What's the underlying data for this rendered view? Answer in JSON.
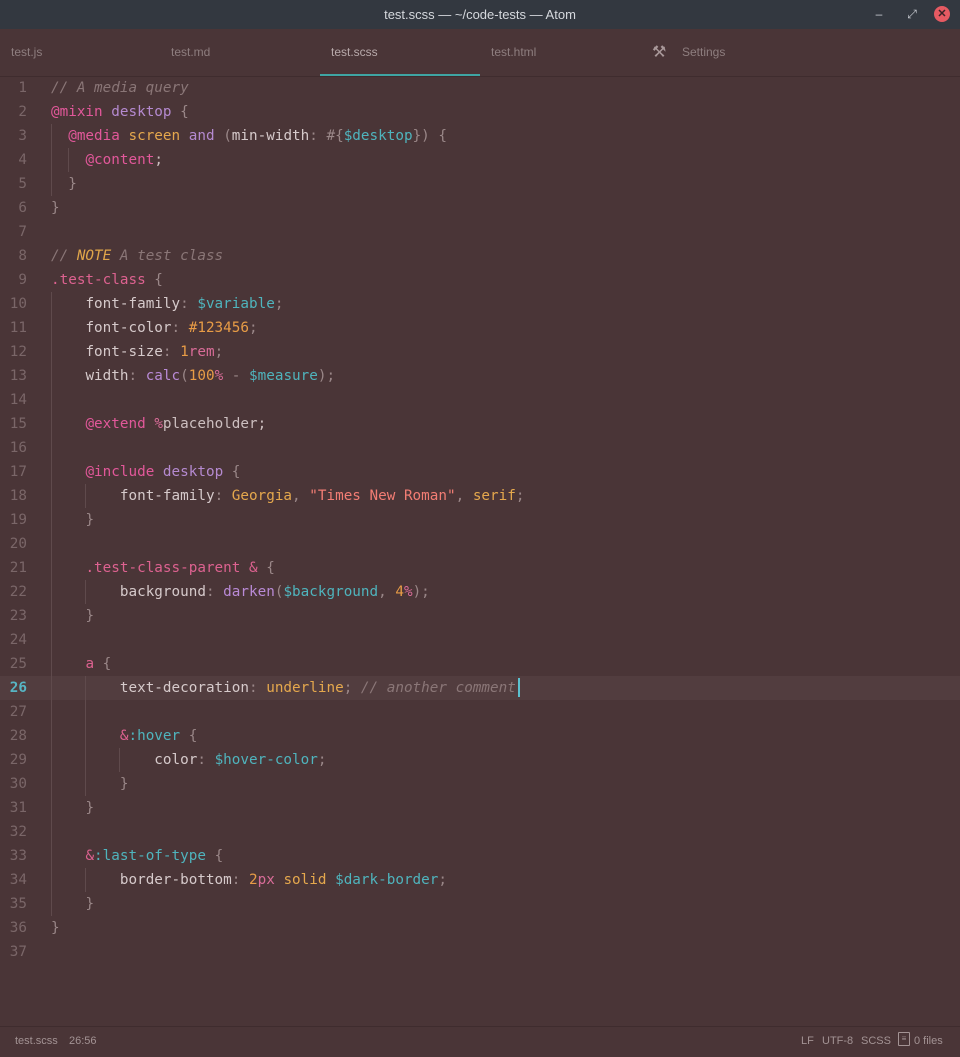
{
  "window": {
    "title": "test.scss — ~/code-tests — Atom",
    "controls": {
      "minimize_icon": "minimize-icon",
      "maximize_icon": "maximize-icon",
      "close_icon": "close-icon"
    }
  },
  "tabs": [
    {
      "label": "test.js",
      "active": false
    },
    {
      "label": "test.md",
      "active": false
    },
    {
      "label": "test.scss",
      "active": true
    },
    {
      "label": "test.html",
      "active": false
    },
    {
      "label": "Settings",
      "active": false,
      "icon": "tools-icon"
    }
  ],
  "editor": {
    "cursor_line": 26,
    "line_numbers": [
      "1",
      "2",
      "3",
      "4",
      "5",
      "6",
      "7",
      "8",
      "9",
      "10",
      "11",
      "12",
      "13",
      "14",
      "15",
      "16",
      "17",
      "18",
      "19",
      "20",
      "21",
      "22",
      "23",
      "24",
      "25",
      "26",
      "27",
      "28",
      "29",
      "30",
      "31",
      "32",
      "33",
      "34",
      "35",
      "36",
      "37"
    ],
    "lines": [
      [
        [
          "c-comment",
          "// A media query"
        ]
      ],
      [
        [
          "c-at",
          "@mixin"
        ],
        [
          "c-pl",
          " "
        ],
        [
          "c-kw",
          "desktop"
        ],
        [
          "c-pl",
          " "
        ],
        [
          "c-punc",
          "{"
        ]
      ],
      [
        [
          "c-pl",
          "  "
        ],
        [
          "c-at",
          "@media"
        ],
        [
          "c-pl",
          " "
        ],
        [
          "c-val",
          "screen"
        ],
        [
          "c-pl",
          " "
        ],
        [
          "c-kw",
          "and"
        ],
        [
          "c-pl",
          " "
        ],
        [
          "c-punc",
          "("
        ],
        [
          "c-prop",
          "min-width"
        ],
        [
          "c-punc",
          ": #{"
        ],
        [
          "c-var",
          "$desktop"
        ],
        [
          "c-punc",
          "}) {"
        ]
      ],
      [
        [
          "c-pl",
          "    "
        ],
        [
          "c-at",
          "@content"
        ],
        [
          "c-pl",
          ";"
        ]
      ],
      [
        [
          "c-pl",
          "  "
        ],
        [
          "c-punc",
          "}"
        ]
      ],
      [
        [
          "c-punc",
          "}"
        ]
      ],
      [],
      [
        [
          "c-comment",
          "// "
        ],
        [
          "c-note",
          "NOTE"
        ],
        [
          "c-comment",
          " A test class"
        ]
      ],
      [
        [
          "c-sel",
          ".test-class"
        ],
        [
          "c-pl",
          " "
        ],
        [
          "c-punc",
          "{"
        ]
      ],
      [
        [
          "c-pl",
          "    "
        ],
        [
          "c-prop",
          "font-family"
        ],
        [
          "c-punc",
          ": "
        ],
        [
          "c-var",
          "$variable"
        ],
        [
          "c-punc",
          ";"
        ]
      ],
      [
        [
          "c-pl",
          "    "
        ],
        [
          "c-prop",
          "font-color"
        ],
        [
          "c-punc",
          ": "
        ],
        [
          "c-num",
          "#123456"
        ],
        [
          "c-punc",
          ";"
        ]
      ],
      [
        [
          "c-pl",
          "    "
        ],
        [
          "c-prop",
          "font-size"
        ],
        [
          "c-punc",
          ": "
        ],
        [
          "c-num",
          "1"
        ],
        [
          "c-unit",
          "rem"
        ],
        [
          "c-punc",
          ";"
        ]
      ],
      [
        [
          "c-pl",
          "    "
        ],
        [
          "c-prop",
          "width"
        ],
        [
          "c-punc",
          ": "
        ],
        [
          "c-func",
          "calc"
        ],
        [
          "c-punc",
          "("
        ],
        [
          "c-num",
          "100"
        ],
        [
          "c-unit",
          "%"
        ],
        [
          "c-punc",
          " - "
        ],
        [
          "c-var",
          "$measure"
        ],
        [
          "c-punc",
          ");"
        ]
      ],
      [],
      [
        [
          "c-pl",
          "    "
        ],
        [
          "c-at",
          "@extend"
        ],
        [
          "c-pl",
          " "
        ],
        [
          "c-unit",
          "%"
        ],
        [
          "c-pl",
          "placeholder;"
        ]
      ],
      [],
      [
        [
          "c-pl",
          "    "
        ],
        [
          "c-at",
          "@include"
        ],
        [
          "c-pl",
          " "
        ],
        [
          "c-kw",
          "desktop"
        ],
        [
          "c-pl",
          " "
        ],
        [
          "c-punc",
          "{"
        ]
      ],
      [
        [
          "c-pl",
          "        "
        ],
        [
          "c-prop",
          "font-family"
        ],
        [
          "c-punc",
          ": "
        ],
        [
          "c-val",
          "Georgia"
        ],
        [
          "c-punc",
          ", "
        ],
        [
          "c-str",
          "\"Times New Roman\""
        ],
        [
          "c-punc",
          ", "
        ],
        [
          "c-val",
          "serif"
        ],
        [
          "c-punc",
          ";"
        ]
      ],
      [
        [
          "c-pl",
          "    "
        ],
        [
          "c-punc",
          "}"
        ]
      ],
      [],
      [
        [
          "c-pl",
          "    "
        ],
        [
          "c-sel",
          ".test-class-parent"
        ],
        [
          "c-pl",
          " "
        ],
        [
          "c-sel",
          "&"
        ],
        [
          "c-pl",
          " "
        ],
        [
          "c-punc",
          "{"
        ]
      ],
      [
        [
          "c-pl",
          "        "
        ],
        [
          "c-prop",
          "background"
        ],
        [
          "c-punc",
          ": "
        ],
        [
          "c-func",
          "darken"
        ],
        [
          "c-punc",
          "("
        ],
        [
          "c-var",
          "$background"
        ],
        [
          "c-punc",
          ", "
        ],
        [
          "c-num",
          "4"
        ],
        [
          "c-unit",
          "%"
        ],
        [
          "c-punc",
          ");"
        ]
      ],
      [
        [
          "c-pl",
          "    "
        ],
        [
          "c-punc",
          "}"
        ]
      ],
      [],
      [
        [
          "c-pl",
          "    "
        ],
        [
          "c-sel",
          "a"
        ],
        [
          "c-pl",
          " "
        ],
        [
          "c-punc",
          "{"
        ]
      ],
      [
        [
          "c-pl",
          "        "
        ],
        [
          "c-prop",
          "text-decoration"
        ],
        [
          "c-punc",
          ": "
        ],
        [
          "c-val",
          "underline"
        ],
        [
          "c-punc",
          "; "
        ],
        [
          "c-comment",
          "// another comment"
        ]
      ],
      [],
      [
        [
          "c-pl",
          "        "
        ],
        [
          "c-sel",
          "&"
        ],
        [
          "c-var",
          ":hover"
        ],
        [
          "c-pl",
          " "
        ],
        [
          "c-punc",
          "{"
        ]
      ],
      [
        [
          "c-pl",
          "            "
        ],
        [
          "c-prop",
          "color"
        ],
        [
          "c-punc",
          ": "
        ],
        [
          "c-var",
          "$hover-color"
        ],
        [
          "c-punc",
          ";"
        ]
      ],
      [
        [
          "c-pl",
          "        "
        ],
        [
          "c-punc",
          "}"
        ]
      ],
      [
        [
          "c-pl",
          "    "
        ],
        [
          "c-punc",
          "}"
        ]
      ],
      [],
      [
        [
          "c-pl",
          "    "
        ],
        [
          "c-sel",
          "&"
        ],
        [
          "c-var",
          ":last-of-type"
        ],
        [
          "c-pl",
          " "
        ],
        [
          "c-punc",
          "{"
        ]
      ],
      [
        [
          "c-pl",
          "        "
        ],
        [
          "c-prop",
          "border-bottom"
        ],
        [
          "c-punc",
          ": "
        ],
        [
          "c-num",
          "2"
        ],
        [
          "c-unit",
          "px"
        ],
        [
          "c-pl",
          " "
        ],
        [
          "c-val",
          "solid"
        ],
        [
          "c-pl",
          " "
        ],
        [
          "c-var",
          "$dark-border"
        ],
        [
          "c-punc",
          ";"
        ]
      ],
      [
        [
          "c-pl",
          "    "
        ],
        [
          "c-punc",
          "}"
        ]
      ],
      [
        [
          "c-punc",
          "}"
        ]
      ],
      []
    ]
  },
  "statusbar": {
    "file": "test.scss",
    "position": "26:56",
    "line_ending": "LF",
    "encoding": "UTF-8",
    "grammar": "SCSS",
    "git_icon": "file-icon",
    "files": "0 files"
  },
  "colors": {
    "background": "#4a3537",
    "titlebar": "#333840",
    "accent": "#3fa5a3",
    "cursor": "#5bc1d0"
  }
}
